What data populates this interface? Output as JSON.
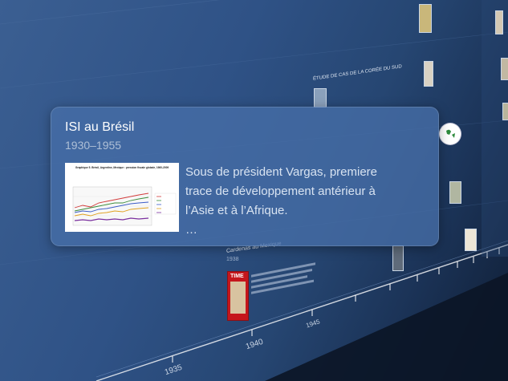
{
  "popup": {
    "title": "ISI au Brésil",
    "dates": "1930–1955",
    "description_lines": [
      "Sous de président Vargas, premiere",
      "trace de développement antérieur à",
      "l’Asie et à l’Afrique.",
      "…"
    ],
    "thumbnail": {
      "chart_title": "Graphique 5. Brésil, Argentine, Mexique : pression fiscale globale, 1960-2009"
    }
  },
  "timeline": {
    "years": [
      "1935",
      "1940",
      "1945"
    ],
    "events": [
      {
        "label": "ÉTUDE DE CAS DE LA CORÉE DU SUD"
      },
      {
        "label": "Cardenas au Mexique",
        "date": "1938"
      }
    ],
    "timecard_text": "TIME"
  },
  "colors": {
    "background": "#2d4e7e",
    "popup": "#466ea8",
    "accent_red": "#c5161c"
  }
}
